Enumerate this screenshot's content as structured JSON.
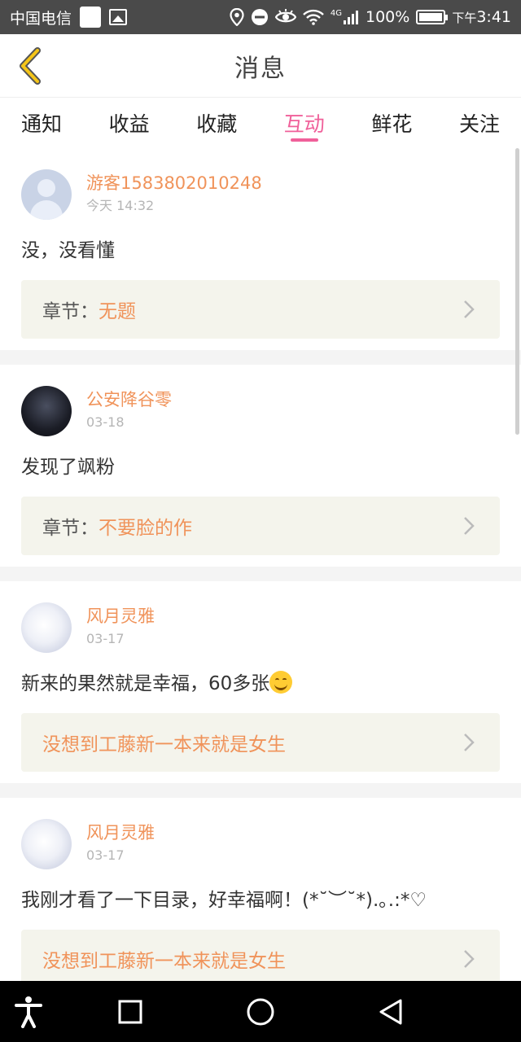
{
  "status_bar": {
    "carrier": "中国电信",
    "network": "4G",
    "battery_percent": "100%",
    "battery_level": 1.0,
    "time_prefix": "下午",
    "time": "3:41"
  },
  "header": {
    "title": "消息"
  },
  "tabs": [
    {
      "label": "通知",
      "active": false
    },
    {
      "label": "收益",
      "active": false
    },
    {
      "label": "收藏",
      "active": false
    },
    {
      "label": "互动",
      "active": true
    },
    {
      "label": "鲜花",
      "active": false
    },
    {
      "label": "关注",
      "active": false
    }
  ],
  "messages": [
    {
      "username": "游客1583802010248",
      "time": "今天 14:32",
      "content": "没，没看懂",
      "chapter_prefix": "章节：",
      "chapter_name": "无题",
      "avatar": "guest-avatar"
    },
    {
      "username": "公安降谷零",
      "time": "03-18",
      "content": "发现了飒粉",
      "chapter_prefix": "章节：",
      "chapter_name": "不要脸的作",
      "avatar": "dark-avatar"
    },
    {
      "username": "风月灵雅",
      "time": "03-17",
      "content": "新来的果然就是幸福，60多张",
      "has_emoji": true,
      "chapter_prefix": "",
      "chapter_name": "没想到工藤新一本来就是女生",
      "avatar": "light-avatar"
    },
    {
      "username": "风月灵雅",
      "time": "03-17",
      "content": "我刚才看了一下目录，好幸福啊！(*˘︶˘*).｡.:*♡",
      "chapter_prefix": "",
      "chapter_name": "没想到工藤新一本来就是女生",
      "avatar": "light-avatar"
    }
  ],
  "colors": {
    "accent_pink": "#f0609a",
    "username_orange": "#f0935a",
    "chapter_bg": "#f4f4ec"
  },
  "navbar": {
    "icons": [
      "accessibility-icon",
      "recent-apps-icon",
      "home-icon",
      "back-icon"
    ]
  }
}
